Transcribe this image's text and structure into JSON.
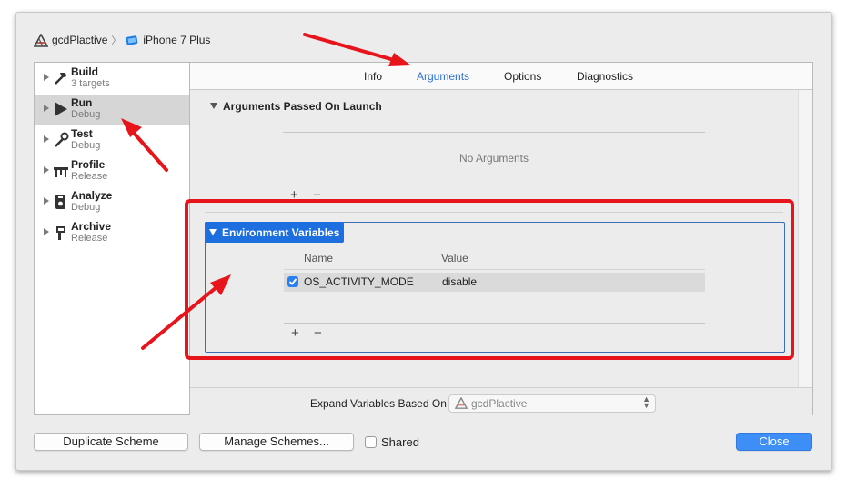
{
  "breadcrumb": {
    "project": "gcdPlactive",
    "device": "iPhone 7 Plus"
  },
  "sidebar": {
    "items": [
      {
        "name": "Build",
        "sub": "3 targets",
        "icon": "hammer-icon"
      },
      {
        "name": "Run",
        "sub": "Debug",
        "icon": "play-icon",
        "selected": true
      },
      {
        "name": "Test",
        "sub": "Debug",
        "icon": "wrench-icon"
      },
      {
        "name": "Profile",
        "sub": "Release",
        "icon": "instruments-icon"
      },
      {
        "name": "Analyze",
        "sub": "Debug",
        "icon": "analyze-icon"
      },
      {
        "name": "Archive",
        "sub": "Release",
        "icon": "archive-icon"
      }
    ]
  },
  "tabs": [
    "Info",
    "Arguments",
    "Options",
    "Diagnostics"
  ],
  "active_tab": "Arguments",
  "arguments": {
    "title": "Arguments Passed On Launch",
    "empty_text": "No Arguments",
    "add": "+",
    "remove": "−"
  },
  "env": {
    "title": "Environment Variables",
    "col_name": "Name",
    "col_value": "Value",
    "rows": [
      {
        "enabled": true,
        "name": "OS_ACTIVITY_MODE",
        "value": "disable"
      }
    ],
    "add": "+",
    "remove": "−"
  },
  "expand": {
    "label": "Expand Variables Based On",
    "value": "gcdPlactive"
  },
  "buttons": {
    "duplicate": "Duplicate Scheme",
    "manage": "Manage Schemes...",
    "shared": "Shared",
    "close": "Close"
  },
  "colors": {
    "accent": "#1d6fe0",
    "annotation": "#e8141c"
  }
}
